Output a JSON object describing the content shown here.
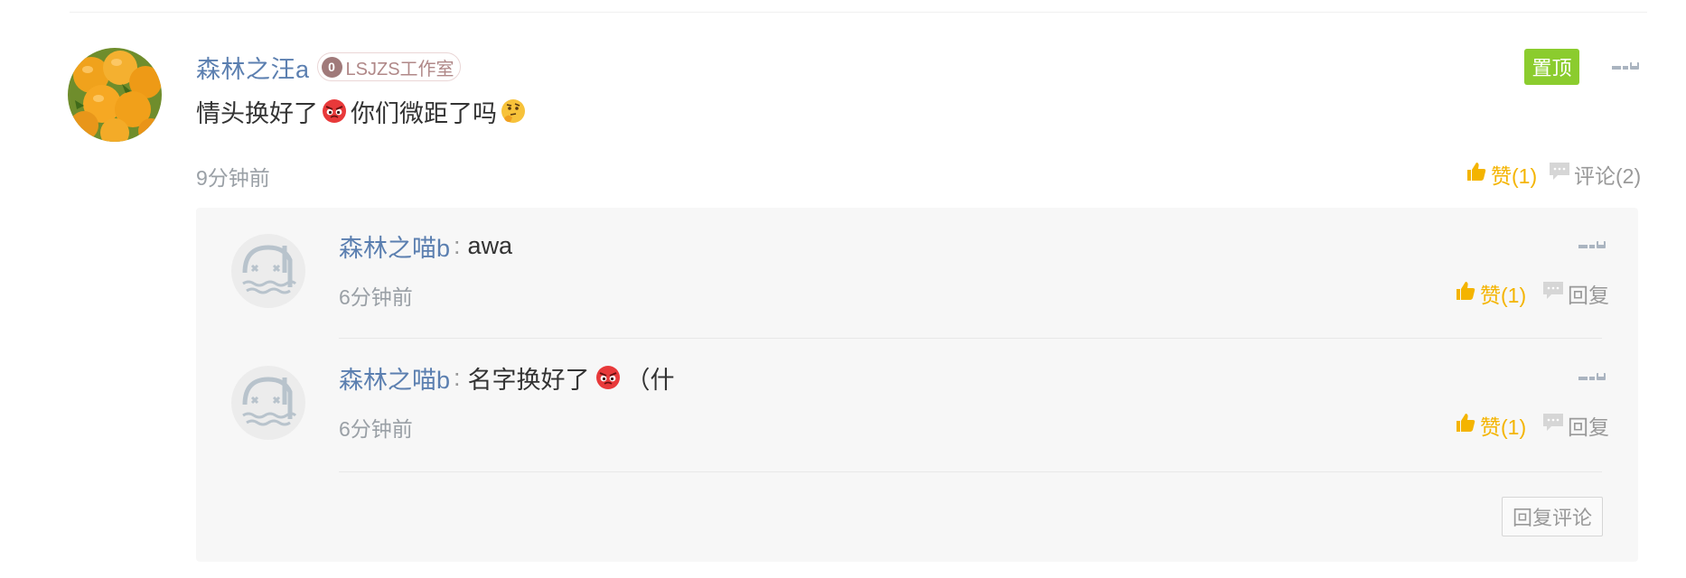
{
  "post": {
    "author": "森林之汪a",
    "badge_level": "0",
    "badge_label": "LSJZS工作室",
    "pin_label": "置顶",
    "text_part1": "情头换好了",
    "text_part2": "你们微距了吗",
    "time": "9分钟前",
    "like_label": "赞(1)",
    "comment_label": "评论(2)",
    "colors": {
      "accent_blue": "#5b7fb0",
      "like_yellow": "#f4b400",
      "pin_green": "#8bcc2e"
    }
  },
  "replies": [
    {
      "author": "森林之喵b",
      "separator": ":",
      "text": "awa",
      "text_suffix": "",
      "time": "6分钟前",
      "like_label": "赞(1)",
      "reply_label": "回复"
    },
    {
      "author": "森林之喵b",
      "separator": ":",
      "text": "名字换好了",
      "text_suffix": "（什",
      "time": "6分钟前",
      "like_label": "赞(1)",
      "reply_label": "回复"
    }
  ],
  "reply_comment_button": "回复评论",
  "icons": {
    "more": "more-dash-icon",
    "like": "thumbs-up-icon",
    "comment": "speech-bubble-icon",
    "emoji_angry": "angry-face-emoji",
    "emoji_thinking": "thinking-face-emoji"
  }
}
